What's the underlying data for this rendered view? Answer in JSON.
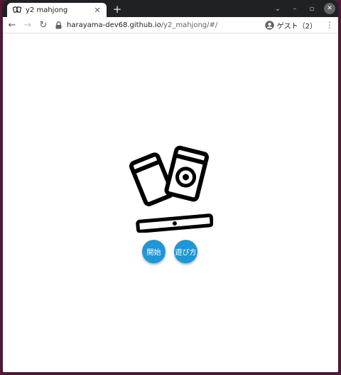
{
  "browser": {
    "tab": {
      "title": "y2 mahjong",
      "close_icon": "close-icon",
      "favicon": "mahjong-favicon-icon"
    },
    "new_tab_label": "+",
    "window_controls": {
      "dropdown": "⌄",
      "minimize": "–",
      "maximize": "▫",
      "close": "✕"
    },
    "toolbar": {
      "back": "←",
      "forward": "→",
      "reload": "↻",
      "url_host": "harayama-dev68.github.io",
      "url_path": "/y2_mahjong/#/",
      "profile_label": "ゲスト（2）",
      "menu": "⋮"
    }
  },
  "page": {
    "logo_icon": "mahjong-tiles-logo-icon",
    "buttons": {
      "start_label": "開始",
      "howto_label": "遊び方"
    },
    "colors": {
      "button": "#1e96d8",
      "logo": "#000000"
    }
  }
}
